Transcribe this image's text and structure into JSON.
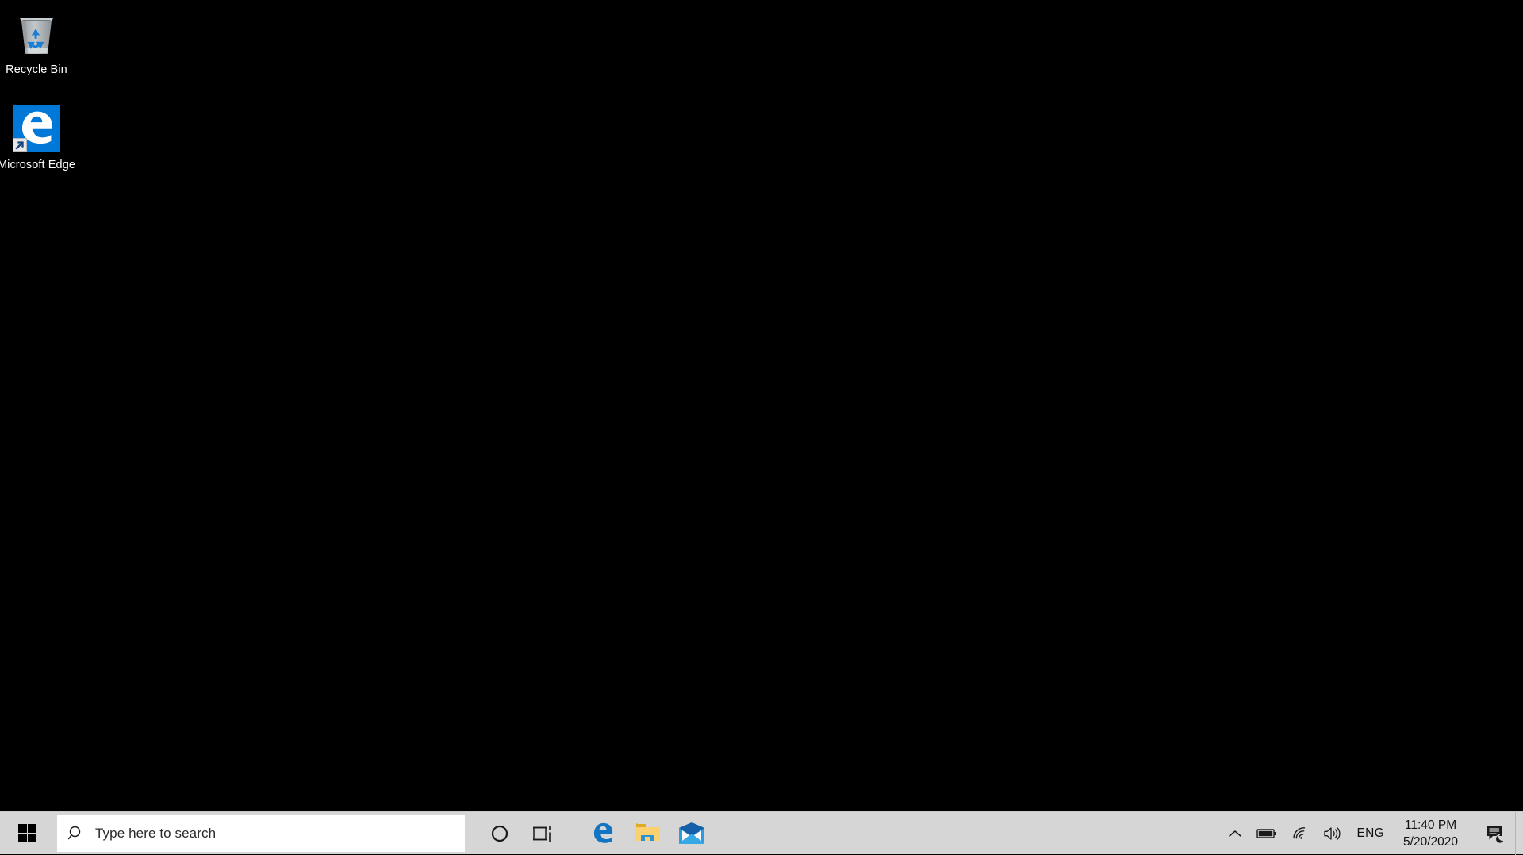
{
  "desktop": {
    "background_color": "#000000",
    "icons": [
      {
        "name": "recycle-bin",
        "label": "Recycle Bin",
        "icon": "recycle-bin-icon",
        "has_shortcut_overlay": false
      },
      {
        "name": "microsoft-edge",
        "label": "Microsoft Edge",
        "icon": "edge-icon",
        "tile_color": "#0078D7",
        "glyph": "e",
        "has_shortcut_overlay": true
      }
    ]
  },
  "taskbar": {
    "background_color": "#d6d6d6",
    "start": {
      "name": "start-button",
      "icon": "windows-logo-icon",
      "tooltip": "Start"
    },
    "search": {
      "name": "search-input",
      "placeholder": "Type here to search",
      "value": "",
      "icon": "search-icon"
    },
    "buttons": [
      {
        "name": "cortana-button",
        "icon": "cortana-circle-icon",
        "label": "Cortana"
      },
      {
        "name": "task-view-button",
        "icon": "task-view-icon",
        "label": "Task View"
      }
    ],
    "pinned": [
      {
        "name": "taskbar-edge",
        "icon": "edge-icon",
        "label": "Microsoft Edge"
      },
      {
        "name": "taskbar-file-explorer",
        "icon": "folder-icon",
        "label": "File Explorer"
      },
      {
        "name": "taskbar-mail",
        "icon": "mail-icon",
        "label": "Mail"
      }
    ],
    "tray": {
      "overflow": {
        "name": "show-hidden-icons",
        "icon": "chevron-up-icon"
      },
      "items": [
        {
          "name": "battery-icon",
          "icon": "battery-icon",
          "label": "Battery"
        },
        {
          "name": "network-icon",
          "icon": "wifi-icon",
          "label": "Network"
        },
        {
          "name": "volume-icon",
          "icon": "speaker-icon",
          "label": "Volume"
        }
      ],
      "language": "ENG",
      "clock": {
        "time": "11:40 PM",
        "date": "5/20/2020"
      },
      "action_center": {
        "name": "action-center-button",
        "icon": "notification-bubble-icon",
        "badge": "quiet-hours-moon"
      },
      "show_desktop": {
        "name": "show-desktop-button"
      }
    }
  }
}
